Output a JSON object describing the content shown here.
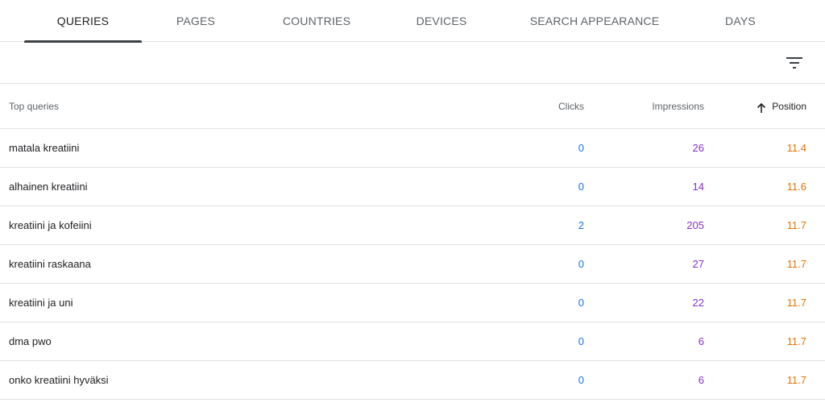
{
  "tabs": [
    {
      "label": "QUERIES",
      "active": true
    },
    {
      "label": "PAGES",
      "active": false
    },
    {
      "label": "COUNTRIES",
      "active": false
    },
    {
      "label": "DEVICES",
      "active": false
    },
    {
      "label": "SEARCH APPEARANCE",
      "active": false
    },
    {
      "label": "DAYS",
      "active": false
    }
  ],
  "filter": {
    "icon": "filter-list-icon"
  },
  "table": {
    "headers": {
      "query": "Top queries",
      "clicks": "Clicks",
      "impressions": "Impressions",
      "position": "Position"
    },
    "sort": {
      "column": "position",
      "direction": "ascending",
      "icon": "arrow-upward-icon"
    },
    "rows": [
      {
        "query": "matala kreatiini",
        "clicks": "0",
        "impressions": "26",
        "position": "11.4"
      },
      {
        "query": "alhainen kreatiini",
        "clicks": "0",
        "impressions": "14",
        "position": "11.6"
      },
      {
        "query": "kreatiini ja kofeiini",
        "clicks": "2",
        "impressions": "205",
        "position": "11.7"
      },
      {
        "query": "kreatiini raskaana",
        "clicks": "0",
        "impressions": "27",
        "position": "11.7"
      },
      {
        "query": "kreatiini ja uni",
        "clicks": "0",
        "impressions": "22",
        "position": "11.7"
      },
      {
        "query": "dma pwo",
        "clicks": "0",
        "impressions": "6",
        "position": "11.7"
      },
      {
        "query": "onko kreatiini hyväksi",
        "clicks": "0",
        "impressions": "6",
        "position": "11.7"
      }
    ]
  },
  "colors": {
    "clicks": "#1a73e8",
    "impressions": "#8430ce",
    "position": "#e37400",
    "active_tab_indicator": "#3c4043",
    "divider": "#e0e0e0"
  }
}
